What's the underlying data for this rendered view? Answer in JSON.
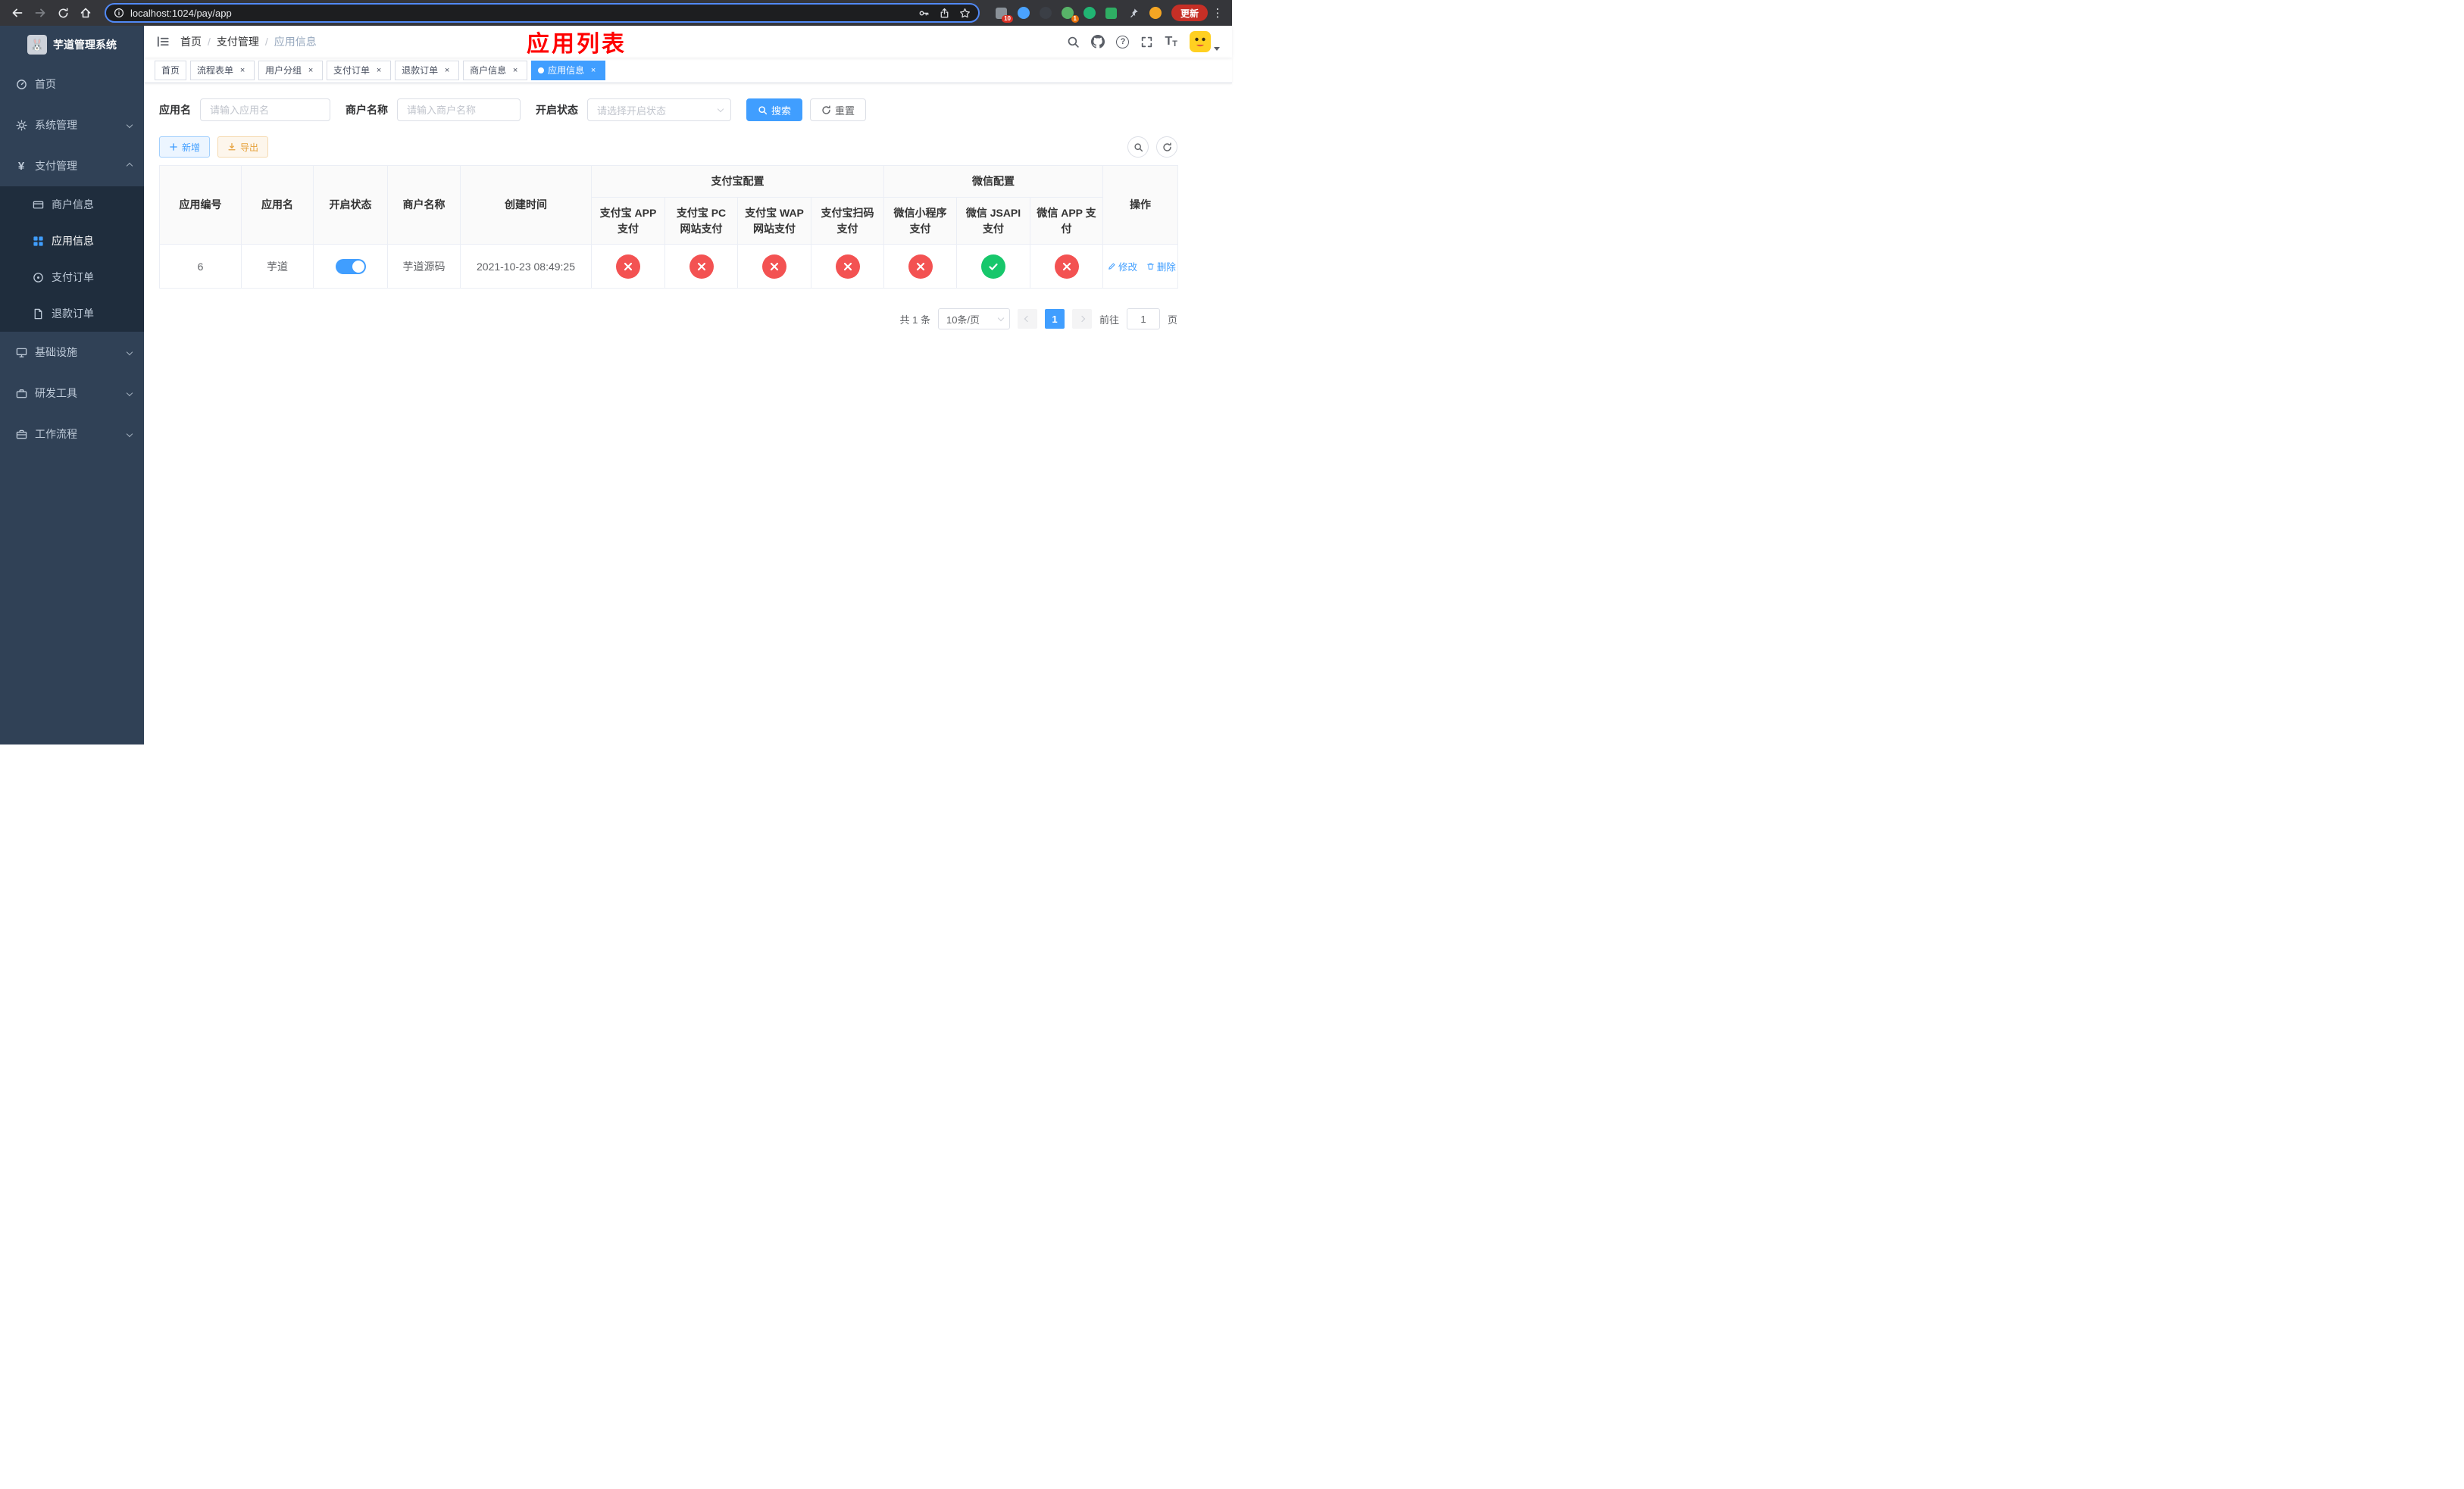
{
  "colors": {
    "accent": "#409eff",
    "danger": "#f35252",
    "success": "#17c76b",
    "warning": "#e6a23c",
    "title-red": "#ff0000"
  },
  "browser": {
    "url": "localhost:1024/pay/app",
    "update_label": "更新",
    "ext_badge_1": "10",
    "ext_badge_2": "1"
  },
  "sidebar": {
    "logo_title": "芋道管理系统",
    "menu": [
      {
        "label": "首页"
      },
      {
        "label": "系统管理"
      },
      {
        "label": "支付管理"
      },
      {
        "label": "商户信息"
      },
      {
        "label": "应用信息"
      },
      {
        "label": "支付订单"
      },
      {
        "label": "退款订单"
      },
      {
        "label": "基础设施"
      },
      {
        "label": "研发工具"
      },
      {
        "label": "工作流程"
      }
    ]
  },
  "header": {
    "breadcrumb": [
      "首页",
      "支付管理",
      "应用信息"
    ],
    "page_title": "应用列表"
  },
  "tabs": [
    {
      "label": "首页"
    },
    {
      "label": "流程表单"
    },
    {
      "label": "用户分组"
    },
    {
      "label": "支付订单"
    },
    {
      "label": "退款订单"
    },
    {
      "label": "商户信息"
    },
    {
      "label": "应用信息"
    }
  ],
  "filters": {
    "app_name_label": "应用名",
    "app_name_placeholder": "请输入应用名",
    "merchant_label": "商户名称",
    "merchant_placeholder": "请输入商户名称",
    "status_label": "开启状态",
    "status_placeholder": "请选择开启状态",
    "search_label": "搜索",
    "reset_label": "重置"
  },
  "toolbar": {
    "add_label": "新增",
    "export_label": "导出"
  },
  "table": {
    "headers": {
      "app_id": "应用编号",
      "app_name": "应用名",
      "status": "开启状态",
      "merchant": "商户名称",
      "created": "创建时间",
      "alipay_group": "支付宝配置",
      "wechat_group": "微信配置",
      "alipay_app": "支付宝 APP 支付",
      "alipay_pc": "支付宝 PC 网站支付",
      "alipay_wap": "支付宝 WAP 网站支付",
      "alipay_qr": "支付宝扫码支付",
      "wx_mini": "微信小程序支付",
      "wx_jsapi": "微信 JSAPI 支付",
      "wx_app": "微信 APP 支付",
      "actions": "操作"
    },
    "rows": [
      {
        "app_id": "6",
        "app_name": "芋道",
        "status_on": true,
        "merchant": "芋道源码",
        "created": "2021-10-23 08:49:25",
        "alipay_app": "no",
        "alipay_pc": "no",
        "alipay_wap": "no",
        "alipay_qr": "no",
        "wx_mini": "no",
        "wx_jsapi": "yes",
        "wx_app": "no",
        "edit_label": "修改",
        "delete_label": "删除"
      }
    ]
  },
  "pagination": {
    "total_label": "共 1 条",
    "page_size": "10条/页",
    "current_page": "1",
    "goto_label": "前往",
    "goto_value": "1",
    "page_suffix": "页"
  }
}
